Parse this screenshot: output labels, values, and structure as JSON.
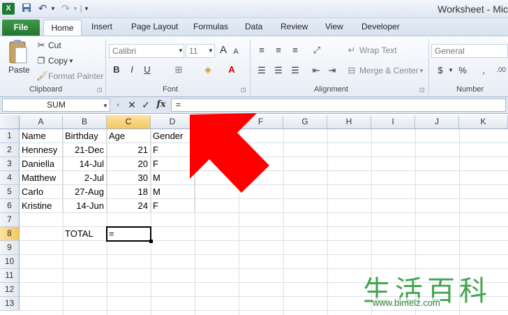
{
  "window": {
    "title": "Worksheet - Mic"
  },
  "quick_access": {
    "separator": "|"
  },
  "tabs": {
    "file": "File",
    "home": "Home",
    "items": [
      "Insert",
      "Page Layout",
      "Formulas",
      "Data",
      "Review",
      "View",
      "Developer"
    ]
  },
  "ribbon": {
    "clipboard": {
      "label": "Clipboard",
      "paste": "Paste",
      "cut": "Cut",
      "copy": "Copy",
      "format_painter": "Format Painter"
    },
    "font": {
      "label": "Font",
      "font_name": "Calibri",
      "font_size": "11",
      "grow": "A",
      "shrink": "A",
      "bold": "B",
      "italic": "I",
      "underline": "U"
    },
    "alignment": {
      "label": "Alignment",
      "wrap_text": "Wrap Text",
      "merge_center": "Merge & Center"
    },
    "number": {
      "label": "Number",
      "format": "General",
      "currency": "$",
      "percent": "%",
      "comma": ","
    }
  },
  "formula_bar": {
    "name_box": "SUM",
    "cancel": "✕",
    "enter": "✓",
    "fx": "fx",
    "formula": "="
  },
  "columns": [
    "A",
    "B",
    "C",
    "D",
    "E",
    "F",
    "G",
    "H",
    "I",
    "J",
    "K"
  ],
  "rows": [
    "1",
    "2",
    "3",
    "4",
    "5",
    "6",
    "7",
    "8",
    "9",
    "10",
    "11",
    "12",
    "13"
  ],
  "sheet": {
    "headers": {
      "a": "Name",
      "b": "Birthday",
      "c": "Age",
      "d": "Gender"
    },
    "records": [
      {
        "name": "Hennesy",
        "birthday": "21-Dec",
        "age": "21",
        "gender": "F"
      },
      {
        "name": "Daniella",
        "birthday": "14-Jul",
        "age": "20",
        "gender": "F"
      },
      {
        "name": "Matthew",
        "birthday": "2-Jul",
        "age": "30",
        "gender": "M"
      },
      {
        "name": "Carlo",
        "birthday": "27-Aug",
        "age": "18",
        "gender": "M"
      },
      {
        "name": "Kristine",
        "birthday": "14-Jun",
        "age": "24",
        "gender": "F"
      }
    ],
    "total_label": "TOTAL",
    "active_value": "="
  },
  "watermark": {
    "chinese": "生活百科",
    "url": "www.bimeiz.com"
  },
  "colors": {
    "arrow": "#ff0000",
    "file_tab": "#2a7f36",
    "selected_header": "#f5c860"
  }
}
